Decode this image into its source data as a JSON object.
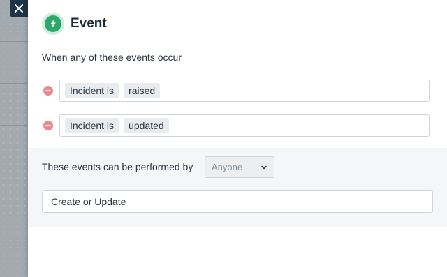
{
  "close_button": {
    "icon": "close-icon"
  },
  "panel": {
    "icon": "lightning-bolt-icon",
    "title": "Event",
    "intro": "When any of these events occur",
    "events": [
      {
        "subject": "Incident is",
        "action": "raised"
      },
      {
        "subject": "Incident is",
        "action": "updated"
      }
    ],
    "performer": {
      "label": "These events can be performed by",
      "selected": "Anyone"
    },
    "mode": {
      "value": "Create or Update"
    }
  },
  "colors": {
    "accent_green": "#2ea86a",
    "remove_red": "#f0868b",
    "close_bg": "#1f3447"
  }
}
